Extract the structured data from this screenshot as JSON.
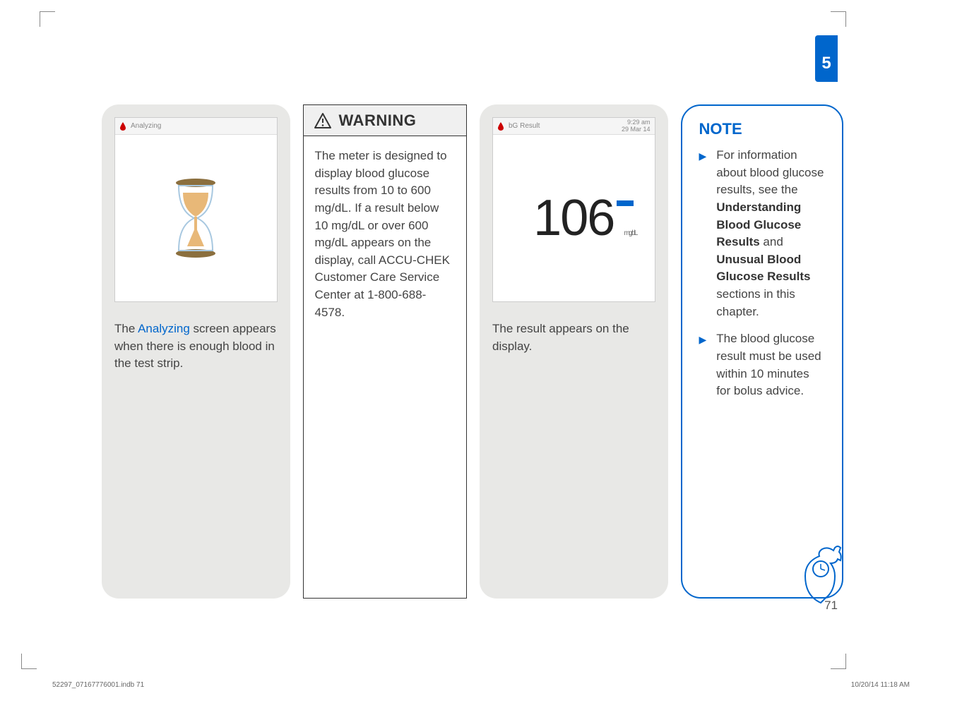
{
  "chapter": {
    "number": "5"
  },
  "col1": {
    "device_header_label": "Analyzing",
    "caption_pre": "The ",
    "caption_highlight": "Analyzing",
    "caption_post": " screen appears when there is enough blood in the test strip."
  },
  "warning": {
    "title": "WARNING",
    "body": "The meter is designed to display blood glucose results from 10 to 600 mg/dL. If a result below 10 mg/dL or over 600 mg/dL appears on the display, call ACCU-CHEK Customer Care Service Center at 1-800-688-4578."
  },
  "col3": {
    "device_header_label": "bG Result",
    "device_time": "9:29 am",
    "device_date": "29 Mar 14",
    "result_value": "106",
    "result_unit": "mg/dL",
    "caption": "The result appears on the display."
  },
  "note": {
    "title": "NOTE",
    "items": [
      {
        "pre": "For information about blood glucose results, see the ",
        "bold1": "Understanding Blood Glucose Results",
        "mid": " and ",
        "bold2": "Unusual Blood Glucose Results",
        "post": " sections in this chapter."
      },
      {
        "text": "The blood glucose result must be used within 10 minutes for bolus advice."
      }
    ]
  },
  "page_number": "71",
  "footer": {
    "left": "52297_07167776001.indb   71",
    "right": "10/20/14   11:18 AM"
  }
}
